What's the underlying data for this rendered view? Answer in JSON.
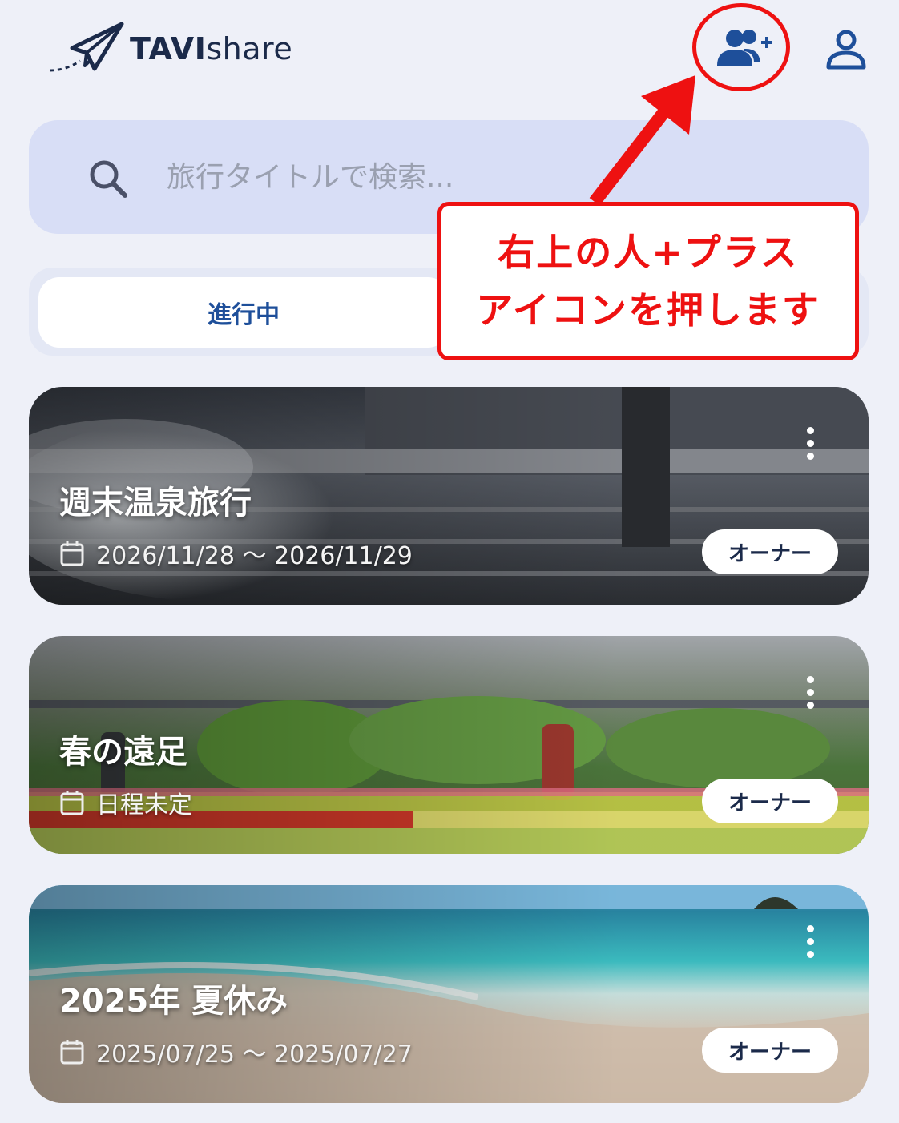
{
  "app": {
    "logo_bold": "TAVI",
    "logo_light": "share"
  },
  "header": {
    "add_member_icon": "person-add-icon",
    "profile_icon": "person-icon"
  },
  "search": {
    "placeholder": "旅行タイトルで検索...",
    "value": ""
  },
  "tabs": [
    {
      "label": "進行中",
      "active": true
    },
    {
      "label": "",
      "active": false
    }
  ],
  "annotation": {
    "line1": "右上の人+プラス",
    "line2": "アイコンを押します",
    "color": "#ee1111"
  },
  "trips": [
    {
      "title": "週末温泉旅行",
      "date": "2026/11/28 ～ 2026/11/29",
      "role": "オーナー",
      "theme": "hot-spring"
    },
    {
      "title": "春の遠足",
      "date": "日程未定",
      "role": "オーナー",
      "theme": "tulip-field"
    },
    {
      "title": "2025年 夏休み",
      "date": "2025/07/25 ～ 2025/07/27",
      "role": "オーナー",
      "theme": "beach"
    }
  ],
  "colors": {
    "background": "#eef0f8",
    "search_bg": "#d8def6",
    "brand_blue": "#1e4f9a",
    "accent_red": "#ee1111"
  }
}
